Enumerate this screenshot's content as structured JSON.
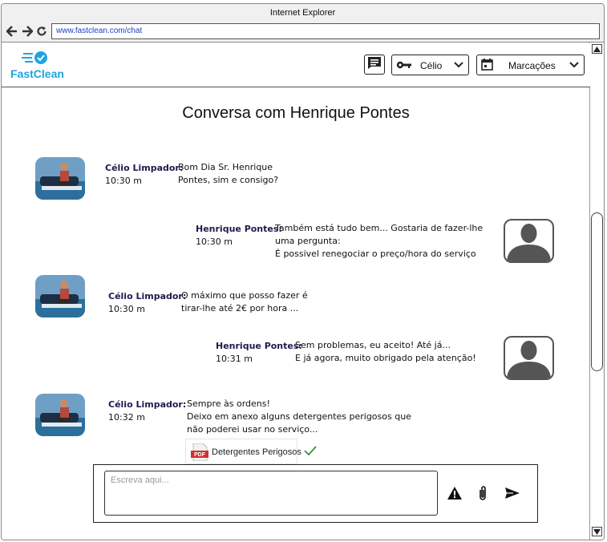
{
  "browser": {
    "title": "Internet Explorer",
    "url": "www.fastclean.com/chat",
    "icons": [
      "back-icon",
      "forward-icon",
      "refresh-icon"
    ]
  },
  "header": {
    "logo_text": "FastClean",
    "user_menu": {
      "label": "Célio",
      "icon": "key-icon"
    },
    "bookings_menu": {
      "label": "Marcações",
      "icon": "calendar-icon"
    },
    "messages_icon": "chat-list-icon"
  },
  "chat": {
    "title": "Conversa com Henrique Pontes",
    "messages": [
      {
        "name": "Célio Limpador:",
        "time": "10:30 m",
        "lines": [
          "Bom Dia Sr. Henrique",
          "Pontes, sim e consigo?"
        ]
      },
      {
        "name": "Henrique Pontes:",
        "time": "10:30 m",
        "lines": [
          "Também está tudo bem... Gostaria de fazer-lhe",
          "uma pergunta:",
          "É possivel renegociar o preço/hora do serviço"
        ]
      },
      {
        "name": "Célio Limpador:",
        "time": "10:30 m",
        "lines": [
          "O máximo que posso fazer é",
          "tirar-lhe até 2€ por hora ..."
        ]
      },
      {
        "name": "Henrique Pontes:",
        "time": "10:31 m",
        "lines": [
          "Sem problemas, eu aceito! Até já...",
          "E já agora, muito obrigado pela atenção!"
        ]
      },
      {
        "name": "Célio Limpador:",
        "time": "10:32 m",
        "lines": [
          "Sempre às ordens!",
          "Deixo em anexo alguns detergentes perigosos que",
          "não poderei usar no serviço..."
        ]
      }
    ],
    "attachment": {
      "name": "Detergentes Perigosos",
      "badge": "PDF"
    }
  },
  "composer": {
    "placeholder": "Escreva aqui...",
    "value": ""
  },
  "colors": {
    "brand": "#1fa3e0",
    "name_text": "#1f1a4d",
    "check": "#3b8f3b",
    "pdf": "#d32f2f"
  }
}
